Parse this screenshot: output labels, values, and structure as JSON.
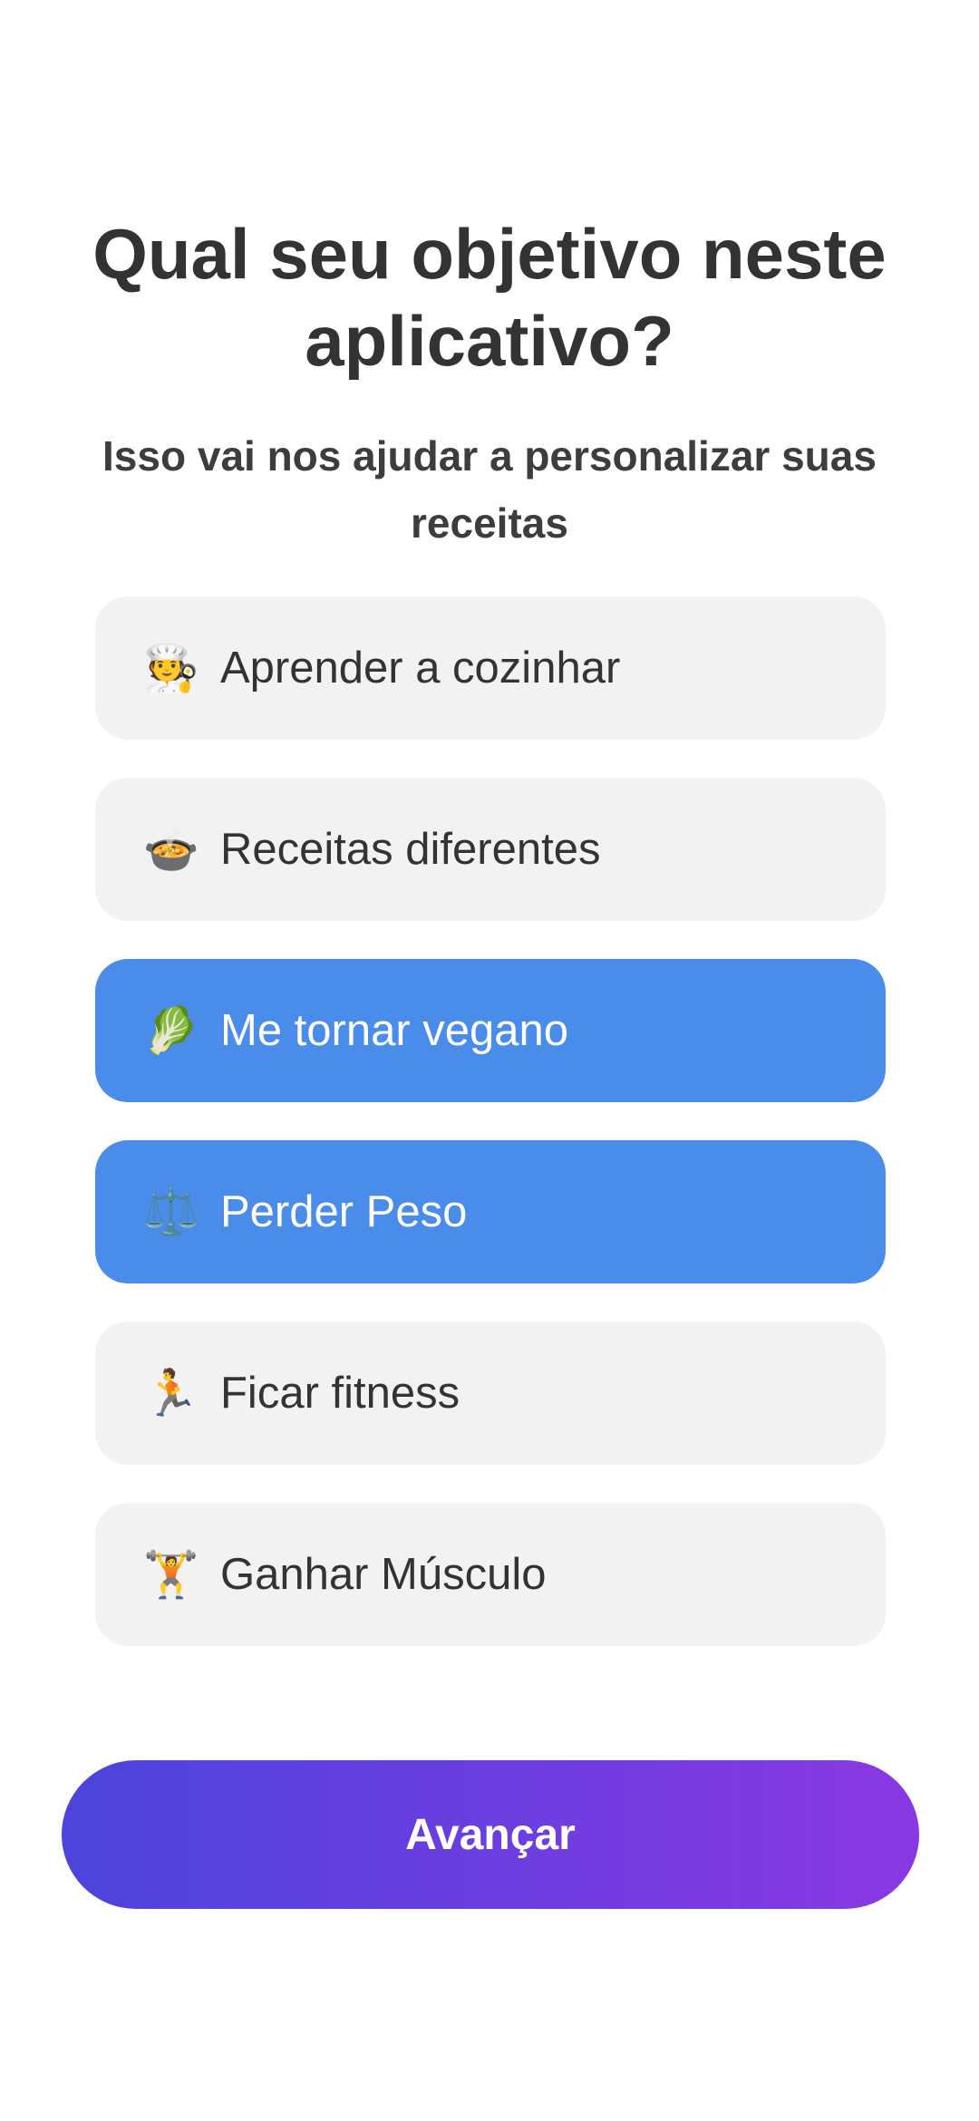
{
  "header": {
    "title": "Qual seu objetivo neste aplicativo?",
    "subtitle": "Isso vai nos ajudar a personalizar suas receitas"
  },
  "options": [
    {
      "emoji": "🧑‍🍳",
      "label": "Aprender a cozinhar",
      "selected": false
    },
    {
      "emoji": "🍲",
      "label": "Receitas diferentes",
      "selected": false
    },
    {
      "emoji": "🥬",
      "label": "Me tornar vegano",
      "selected": true
    },
    {
      "emoji": "⚖️",
      "label": "Perder Peso",
      "selected": true
    },
    {
      "emoji": "🏃",
      "label": "Ficar fitness",
      "selected": false
    },
    {
      "emoji": "🏋️",
      "label": "Ganhar Músculo",
      "selected": false
    }
  ],
  "footer": {
    "next_label": "Avançar"
  },
  "colors": {
    "background": "#ffffff",
    "text": "#333333",
    "option_bg": "#f2f2f2",
    "option_selected_bg": "#4a8ce9",
    "option_selected_text": "#ffffff",
    "button_gradient_start": "#4c44dc",
    "button_gradient_end": "#8a38e2"
  }
}
